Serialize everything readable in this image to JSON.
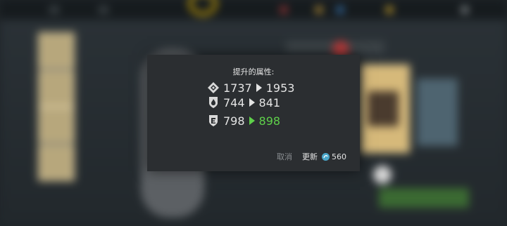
{
  "dialog": {
    "title": "提升的属性:",
    "stats": [
      {
        "icon": "diamond-icon",
        "from": "1737",
        "to": "1953",
        "highlight": false
      },
      {
        "icon": "shield-fire-icon",
        "from": "744",
        "to": "841",
        "highlight": false
      },
      {
        "icon": "shield-e-icon",
        "from": "798",
        "to": "898",
        "highlight": true
      }
    ],
    "cancel_label": "取消",
    "update_label": "更新",
    "cost": "560",
    "colors": {
      "accent_green": "#5ed04a",
      "panel": "#2b2e31",
      "text": "#e4e4e4"
    }
  }
}
